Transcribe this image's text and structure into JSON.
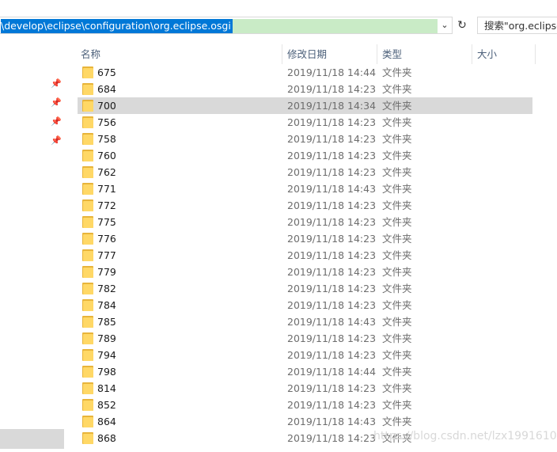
{
  "address_bar": {
    "path": "\\develop\\eclipse\\configuration\\org.eclipse.osgi",
    "dropdown_icon": "chevron-down-icon",
    "refresh_icon": "refresh-icon"
  },
  "search": {
    "placeholder": "搜索\"org.eclipse"
  },
  "columns": {
    "name": "名称",
    "date": "修改日期",
    "type": "类型",
    "size": "大小"
  },
  "rows": [
    {
      "name": "675",
      "date": "2019/11/18 14:44",
      "type": "文件夹"
    },
    {
      "name": "684",
      "date": "2019/11/18 14:23",
      "type": "文件夹"
    },
    {
      "name": "700",
      "date": "2019/11/18 14:34",
      "type": "文件夹",
      "selected": true
    },
    {
      "name": "756",
      "date": "2019/11/18 14:23",
      "type": "文件夹"
    },
    {
      "name": "758",
      "date": "2019/11/18 14:23",
      "type": "文件夹"
    },
    {
      "name": "760",
      "date": "2019/11/18 14:23",
      "type": "文件夹"
    },
    {
      "name": "762",
      "date": "2019/11/18 14:23",
      "type": "文件夹"
    },
    {
      "name": "771",
      "date": "2019/11/18 14:43",
      "type": "文件夹"
    },
    {
      "name": "772",
      "date": "2019/11/18 14:23",
      "type": "文件夹"
    },
    {
      "name": "775",
      "date": "2019/11/18 14:23",
      "type": "文件夹"
    },
    {
      "name": "776",
      "date": "2019/11/18 14:23",
      "type": "文件夹"
    },
    {
      "name": "777",
      "date": "2019/11/18 14:23",
      "type": "文件夹"
    },
    {
      "name": "779",
      "date": "2019/11/18 14:23",
      "type": "文件夹"
    },
    {
      "name": "782",
      "date": "2019/11/18 14:23",
      "type": "文件夹"
    },
    {
      "name": "784",
      "date": "2019/11/18 14:23",
      "type": "文件夹"
    },
    {
      "name": "785",
      "date": "2019/11/18 14:43",
      "type": "文件夹"
    },
    {
      "name": "789",
      "date": "2019/11/18 14:23",
      "type": "文件夹"
    },
    {
      "name": "794",
      "date": "2019/11/18 14:23",
      "type": "文件夹"
    },
    {
      "name": "798",
      "date": "2019/11/18 14:44",
      "type": "文件夹"
    },
    {
      "name": "814",
      "date": "2019/11/18 14:23",
      "type": "文件夹"
    },
    {
      "name": "852",
      "date": "2019/11/18 14:23",
      "type": "文件夹"
    },
    {
      "name": "864",
      "date": "2019/11/18 14:43",
      "type": "文件夹"
    },
    {
      "name": "868",
      "date": "2019/11/18 14:23",
      "type": "文件夹"
    }
  ],
  "watermark": "https://blog.csdn.net/lzx1991610",
  "colors": {
    "selection": "#0078d7",
    "row_selected": "#d9d9d9",
    "folder": "#ffd866"
  }
}
